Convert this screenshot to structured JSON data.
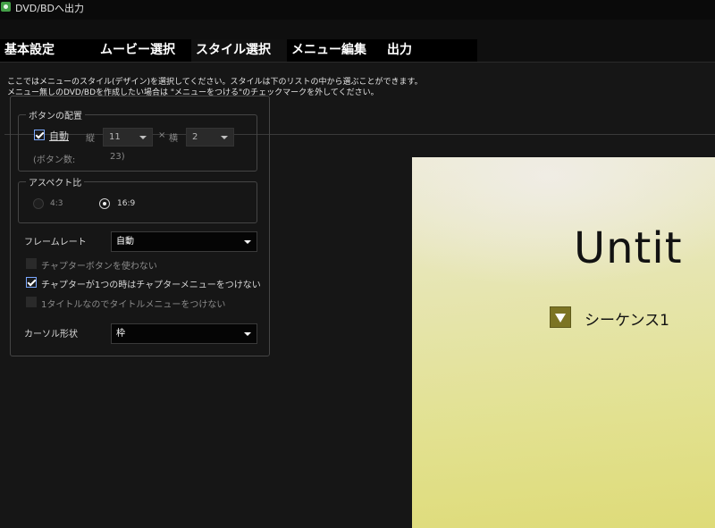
{
  "window": {
    "title": "DVD/BDへ出力"
  },
  "tabs": [
    "基本設定",
    "ムービー選択",
    "スタイル選択",
    "メニュー編集",
    "出力"
  ],
  "description": {
    "line1": "ここではメニューのスタイル(デザイン)を選択してください。スタイルは下のリストの中から選ぶことができます。",
    "line2": "メニュー無しのDVD/BDを作成したい場合は \"メニューをつける\"のチェックマークを外してください。"
  },
  "button_layout": {
    "legend": "ボタンの配置",
    "auto_label": "自動",
    "auto_checked": true,
    "rows_label": "縦",
    "rows_value": "11",
    "times": "×",
    "cols_label": "横",
    "cols_value": "2",
    "count_label": "(ボタン数:",
    "count_value": "23)"
  },
  "aspect": {
    "legend": "アスペクト比",
    "options": [
      "4:3",
      "16:9"
    ],
    "selected": "16:9"
  },
  "frame_rate": {
    "label": "フレームレート",
    "value": "自動"
  },
  "options": {
    "no_chapter_buttons": {
      "label": "チャプターボタンを使わない",
      "checked": false
    },
    "no_chapter_menu_single": {
      "label": "チャプターが1つの時はチャプターメニューをつけない",
      "checked": true
    },
    "no_title_menu_single": {
      "label": "1タイトルなのでタイトルメニューをつけない",
      "checked": false
    }
  },
  "cursor_shape": {
    "label": "カーソル形状",
    "value": "枠"
  },
  "preview": {
    "title": "Untit",
    "item": "シーケンス1"
  },
  "colors": {
    "background": "#161616",
    "accent": "#7aa8ff",
    "preview_icon": "#7c7424"
  }
}
